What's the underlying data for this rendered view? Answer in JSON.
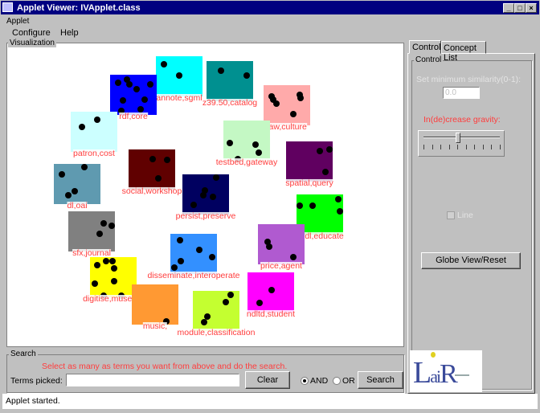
{
  "window": {
    "title": "Applet Viewer: IVApplet.class",
    "applet_menu": "Applet",
    "menus": [
      "Configure",
      "Help"
    ]
  },
  "visualization": {
    "legend": "Visualization",
    "nodes": [
      {
        "label": "annote,sgml",
        "color": "#00ffff"
      },
      {
        "label": "rdf,core",
        "color": "#0000ff"
      },
      {
        "label": "z39.50,catalog",
        "color": "#009090"
      },
      {
        "label": "law,culture",
        "color": "#ffaaaa"
      },
      {
        "label": "patron,cost",
        "color": "#ccffff"
      },
      {
        "label": "testbed,gateway",
        "color": "#c4f8c4"
      },
      {
        "label": "spatial,query",
        "color": "#600060"
      },
      {
        "label": "social,workshop",
        "color": "#600000"
      },
      {
        "label": "dl,oai",
        "color": "#5f9ab0"
      },
      {
        "label": "persist,preserve",
        "color": "#000060"
      },
      {
        "label": "nsdl,educate",
        "color": "#00ff00"
      },
      {
        "label": "sfx,journal",
        "color": "#808080"
      },
      {
        "label": "price,agent",
        "color": "#b05ad0"
      },
      {
        "label": "disseminate,interoperate",
        "color": "#3390ff"
      },
      {
        "label": "digitise,museum",
        "color": "#ffff00"
      },
      {
        "label": "ndltd,student",
        "color": "#ff00ff"
      },
      {
        "label": "music,",
        "color": "#ff9933"
      },
      {
        "label": "module,classification",
        "color": "#c4ff30"
      }
    ]
  },
  "control": {
    "tabs": [
      "Control",
      "Concept List"
    ],
    "active_tab": "Control",
    "legend": "Control",
    "similarity_label": "Set minimum similarity(0-1):",
    "similarity_value": "0.0",
    "gravity_label": "In(de)crease gravity:",
    "gravity_level": 0.45,
    "line_label": "Line",
    "line_checked": false,
    "globe_button": "Globe View/Reset"
  },
  "search": {
    "legend": "Search",
    "instruction": "Select as many as terms you want from above and do the search.",
    "terms_label": "Terms picked:",
    "terms_value": "",
    "clear": "Clear",
    "and": "AND",
    "or": "OR",
    "selected": "AND",
    "search": "Search"
  },
  "logo": {
    "text": "LaiR"
  },
  "status": "Applet started.",
  "colors": {
    "titlebar": "#000080",
    "accent_red": "#ff3c3c"
  }
}
